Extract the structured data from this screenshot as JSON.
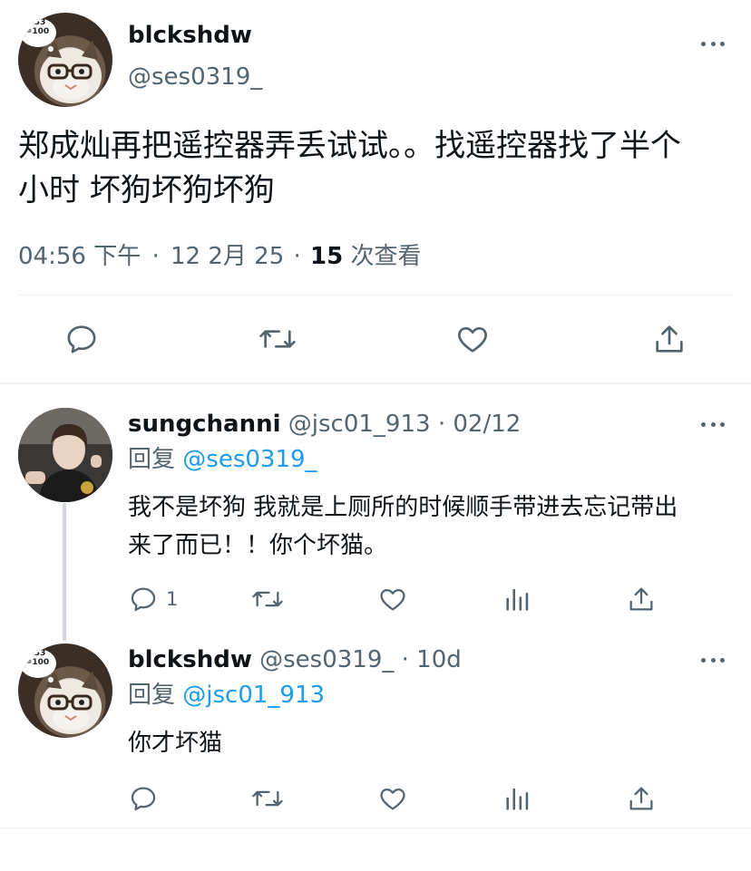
{
  "main_tweet": {
    "display_name": "blckshdw",
    "handle": "@ses0319_",
    "avatar_badge": "133\n=100",
    "text_line1": "郑成灿再把遥控器弄丢试试。。找遥控器找了半个",
    "text_line2": "小时 坏狗坏狗坏狗",
    "time": "04:56 下午",
    "sep1": "·",
    "date": "12 2月 25",
    "sep2": "·",
    "views_count": "15",
    "views_label": "次查看"
  },
  "reply1": {
    "display_name": "sungchanni",
    "handle": "@jsc01_913",
    "sep": "·",
    "date": "02/12",
    "reply_prefix": "回复",
    "reply_to": "@ses0319_",
    "text_line1": "我不是坏狗 我就是上厕所的时候顺手带进去忘记带出",
    "text_line2": "来了而已！！你个坏猫。",
    "reply_count": "1"
  },
  "reply2": {
    "display_name": "blckshdw",
    "handle": "@ses0319_",
    "sep": "·",
    "date": "10d",
    "avatar_badge": "133\n=100",
    "reply_prefix": "回复",
    "reply_to": "@jsc01_913",
    "text": "你才坏猫"
  },
  "colors": {
    "accent": "#1d9bf0",
    "secondary_text": "#536471",
    "divider": "#eff3f4",
    "thread_line": "#cfd9de"
  }
}
